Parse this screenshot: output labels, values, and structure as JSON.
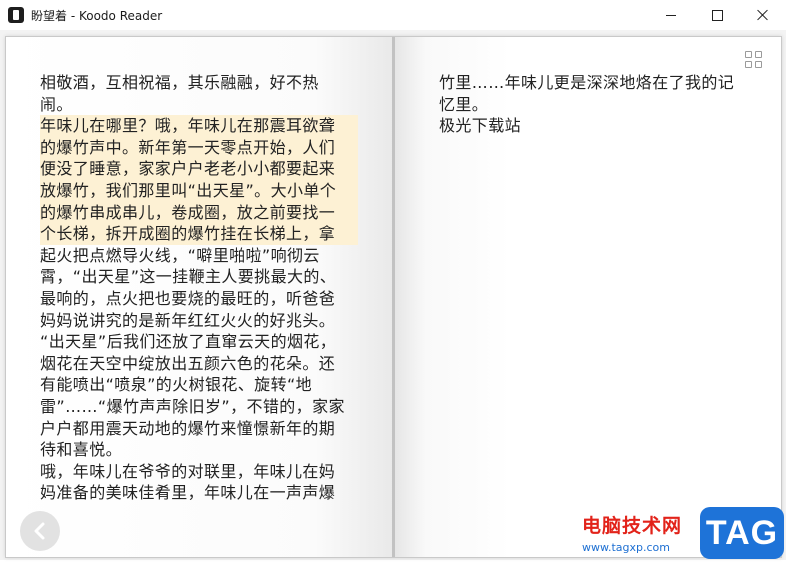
{
  "window": {
    "title": "盼望着 - Koodo Reader"
  },
  "icons": {
    "app": "koodo-reader-app-icon",
    "minimize": "minimize-icon",
    "maximize": "maximize-icon",
    "close": "close-icon",
    "grid": "grid-view-icon",
    "prev": "chevron-left-icon"
  },
  "colors": {
    "highlight": "#fdf1d4",
    "watermark_red": "#e2231a",
    "watermark_blue": "#1e73d8"
  },
  "book": {
    "left_page": {
      "lines": [
        {
          "text": "相敬酒，互相祝福，其乐融融，好不热",
          "highlight": false
        },
        {
          "text": "闹。",
          "highlight": false
        },
        {
          "text": "年味儿在哪里？哦，年味儿在那震耳欲聋",
          "highlight": true
        },
        {
          "text": "的爆竹声中。新年第一天零点开始，人们",
          "highlight": true
        },
        {
          "text": "便没了睡意，家家户户老老小小都要起来",
          "highlight": true
        },
        {
          "text": "放爆竹，我们那里叫“出天星”。大小单个",
          "highlight": true
        },
        {
          "text": "的爆竹串成串儿，卷成圈，放之前要找一",
          "highlight": true
        },
        {
          "text": "个长梯，拆开成圈的爆竹挂在长梯上，拿",
          "highlight": true
        },
        {
          "text": "起火把点燃导火线，“噼里啪啦”响彻云",
          "highlight": false
        },
        {
          "text": "霄，“出天星”这一挂鞭主人要挑最大的、",
          "highlight": false
        },
        {
          "text": "最响的，点火把也要烧的最旺的，听爸爸",
          "highlight": false
        },
        {
          "text": "妈妈说讲究的是新年红红火火的好兆头。",
          "highlight": false
        },
        {
          "text": "“出天星”后我们还放了直窜云天的烟花，",
          "highlight": false
        },
        {
          "text": "烟花在天空中绽放出五颜六色的花朵。还",
          "highlight": false
        },
        {
          "text": "有能喷出“喷泉”的火树银花、旋转“地",
          "highlight": false
        },
        {
          "text": "雷”……“爆竹声声除旧岁”，不错的，家家",
          "highlight": false
        },
        {
          "text": "户户都用震天动地的爆竹来憧憬新年的期",
          "highlight": false
        },
        {
          "text": "待和喜悦。",
          "highlight": false
        },
        {
          "text": "哦，年味儿在爷爷的对联里，年味儿在妈",
          "highlight": false
        },
        {
          "text": "妈准备的美味佳肴里，年味儿在一声声爆",
          "highlight": false
        }
      ]
    },
    "right_page": {
      "lines": [
        {
          "text": "竹里……年味儿更是深深地烙在了我的记",
          "highlight": false
        },
        {
          "text": "忆里。",
          "highlight": false
        },
        {
          "text": "极光下载站",
          "highlight": false
        }
      ]
    }
  },
  "watermark": {
    "site_name": "电脑技术网",
    "url": "www.tagxp.com",
    "tag": "TAG"
  }
}
